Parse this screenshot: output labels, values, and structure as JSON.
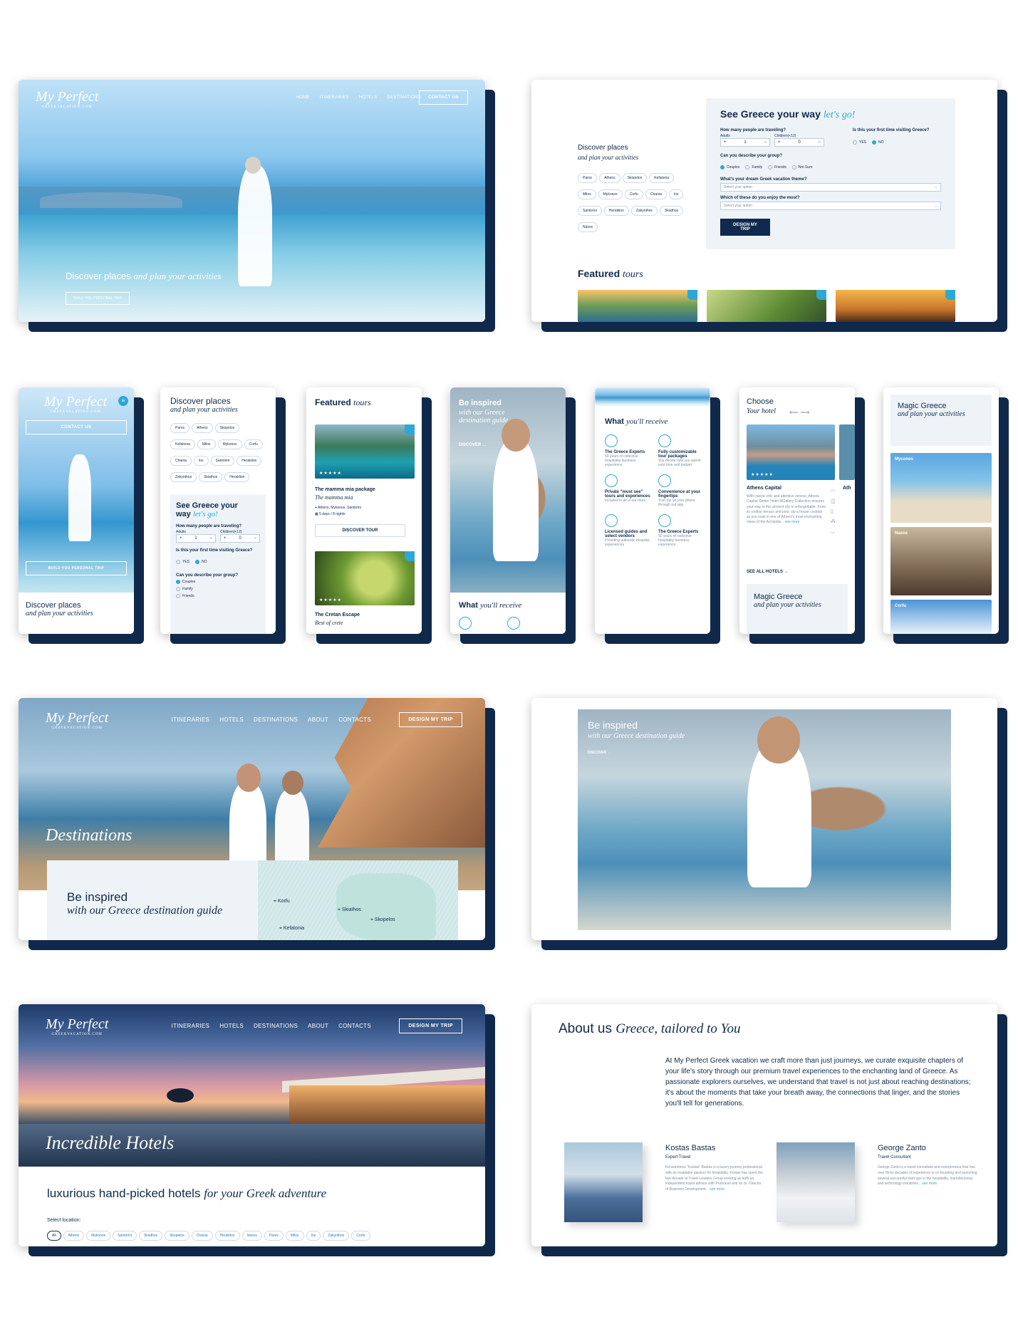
{
  "brand": {
    "logo_script": "My Perfect",
    "logo_sub": "GREEKVACATION.COM"
  },
  "nav1": {
    "items": [
      "HOME",
      "ITINERARIES",
      "HOTELS",
      "DESTINATIONS"
    ],
    "cta": "CONTACT US"
  },
  "hero1": {
    "title": "Discover places",
    "title_italic": "and plan your activities",
    "cta": "BUILD YOU PERSONAL TRIP"
  },
  "discover": {
    "title": "Discover places",
    "subtitle": "and plan your activities",
    "places": [
      "Paros",
      "Athens",
      "Skopelos",
      "Kefalonia",
      "Milos",
      "Mykonos",
      "Corfu",
      "Chania",
      "Ios",
      "Santorini",
      "Heraklion",
      "Zakynthos",
      "Skiathos",
      "Naxos"
    ]
  },
  "form": {
    "title": "See Greece your way",
    "title_italic": "let's go!",
    "q_people": "How many people are traveling?",
    "adults": "Adults",
    "children": "Children(<12)",
    "adults_val": "1",
    "children_val": "0",
    "q_first": "Is this your first time visiting Greece?",
    "yes": "YES",
    "no": "NO",
    "q_group": "Can you describe your group?",
    "groups": [
      "Couples",
      "Family",
      "Friends",
      "Not Sure"
    ],
    "q_theme": "What's your dream Greek vacation theme?",
    "q_enjoy": "Which of these do you enjoy the most?",
    "select_placeholder": "Select your option",
    "cta": "DESIGN MY TRIP"
  },
  "featured": {
    "title": "Featured",
    "title_italic": "tours"
  },
  "mobile": {
    "cta_contact": "CONTACT US",
    "cta_build": "BUILD YOU PERSONAL TRIP",
    "discover_title": "Discover places",
    "discover_sub": "and plan your activities",
    "places": [
      "Paros",
      "Athens",
      "Skopelos",
      "Kefalonia",
      "Milos",
      "Mykonos",
      "Corfu",
      "Chania",
      "Ios",
      "Santorini",
      "Heraklion",
      "Zakynthos",
      "Skiathos",
      "Heraklion"
    ],
    "form_title": "See Greece your",
    "form_title2": "way",
    "form_italic": "let's go!",
    "q_people": "How many people are traveling?",
    "adults": "Adults",
    "children": "Children(<12)",
    "q_first": "Is this your first time visiting Greece?",
    "yes": "YES",
    "no": "NO",
    "q_group": "Can you describe your group?",
    "groups": [
      "Couples",
      "Family",
      "Friends"
    ],
    "tour1_title": "The mamma mia package",
    "tour1_sub": "The mamma mia",
    "tour1_loc": "Athens, Mykonos, Santorini",
    "tour1_days": "5 days / 8 nights",
    "tour_cta": "DISCOVER TOUR",
    "tour2_title": "The Cretan Escape",
    "tour2_sub": "Best of crete",
    "inspired_title": "Be inspired",
    "inspired_sub": "with our Greece destination guide",
    "discover_cta": "DISCOVER",
    "receive_title": "What",
    "receive_italic": "you'll receive",
    "receive": [
      {
        "t": "The Greece Experts",
        "d": "50 years of collective hospitality business experience"
      },
      {
        "t": "Fully customizable tour packages",
        "d": "You decide how you spend your time and budget"
      },
      {
        "t": "Private \"must see\" tours and experiences",
        "d": "Included in all of our tours"
      },
      {
        "t": "Convenience at your fingertips",
        "d": "Your trip on your phone through our app"
      },
      {
        "t": "Licensed guides and select vendors",
        "d": "Providing authentic bespoke experiences"
      },
      {
        "t": "The Greece Experts",
        "d": "50 years of collective hospitality business experience"
      }
    ],
    "hotel_title": "Choose",
    "hotel_italic": "Your hotel",
    "hotel_name": "Athens Capital",
    "hotel_name2": "Ath",
    "hotel_desc": "With classic chic and attentive service, Athens Capital Center Hotel MGallery Collection ensures your stay in this ancient city is unforgettable. From its rooftop terrace and pool, sip a house cocktail as you soak in one of Athens's most enchanting views of the Acropolis...",
    "see_more": "see more",
    "see_all": "SEE ALL HOTELS",
    "magic_title": "Magic Greece",
    "magic_italic": "and plan your activities",
    "dest": [
      "Myconos",
      "Naxos",
      "Corfu"
    ]
  },
  "destinations": {
    "nav": [
      "ITINERARIES",
      "HOTELS",
      "DESTINATIONS",
      "ABOUT",
      "CONTACTS"
    ],
    "cta": "DESIGN MY TRIP",
    "hero": "Destinations",
    "inspired": "Be inspired",
    "inspired_italic": "with our Greece destination guide",
    "map_labels": [
      "Korfu",
      "Skiathos",
      "Skopelos",
      "Kefalonia"
    ]
  },
  "inspired_big": {
    "title": "Be inspired",
    "subtitle": "with our Greece destination guide",
    "cta": "DISCOVER"
  },
  "hotels": {
    "nav": [
      "ITINERARIES",
      "HOTELS",
      "DESTINATIONS",
      "ABOUT",
      "CONTACTS"
    ],
    "cta": "DESIGN MY TRIP",
    "hero": "Incredible Hotels",
    "heading": "luxurious hand-picked hotels",
    "heading_italic": "for your Greek adventure",
    "select": "Select location:",
    "locations": [
      "All",
      "Athens",
      "Mykonos",
      "Santorini",
      "Skiathos",
      "Skopelos",
      "Chania",
      "Heraklion",
      "Naxos",
      "Paros",
      "Milos",
      "Ios",
      "Zakynthos",
      "Corfu"
    ]
  },
  "about": {
    "title": "About us",
    "title_italic": "Greece, tailored to You",
    "text": "At My Perfect Greek vacation we craft more than just journeys, we curate exquisite chapters of your life's story through our premium travel experiences to the enchanting land of Greece. As passionate explorers ourselves, we understand that travel is not just about reaching destinations; it's about the moments that take your breath away, the connections that linger, and the stories you'll tell for generations.",
    "people": [
      {
        "name": "Kostas Bastas",
        "role": "Expert Travel",
        "bio": "Konstantinos \"Kostas\" Bastas is a luxury journey professional with an insatiable passion for hospitality. Kostas has spent the last decade at Travel Leaders Group working as both an independent travel advisor with Probravel and as Sr. Director of Business Development...",
        "more": "see more"
      },
      {
        "name": "George Zanto",
        "role": "Travel Consultant",
        "bio": "George Zanto is a travel consultant and entrepreneur that has over three decades of experience in co-founding and launching several successful start-ups in the hospitality, manufacturing and technology industries...",
        "more": "see more"
      }
    ]
  },
  "colors": {
    "navy": "#0f2a4a",
    "accent": "#2fa6d8",
    "shadow": "#10284a"
  }
}
